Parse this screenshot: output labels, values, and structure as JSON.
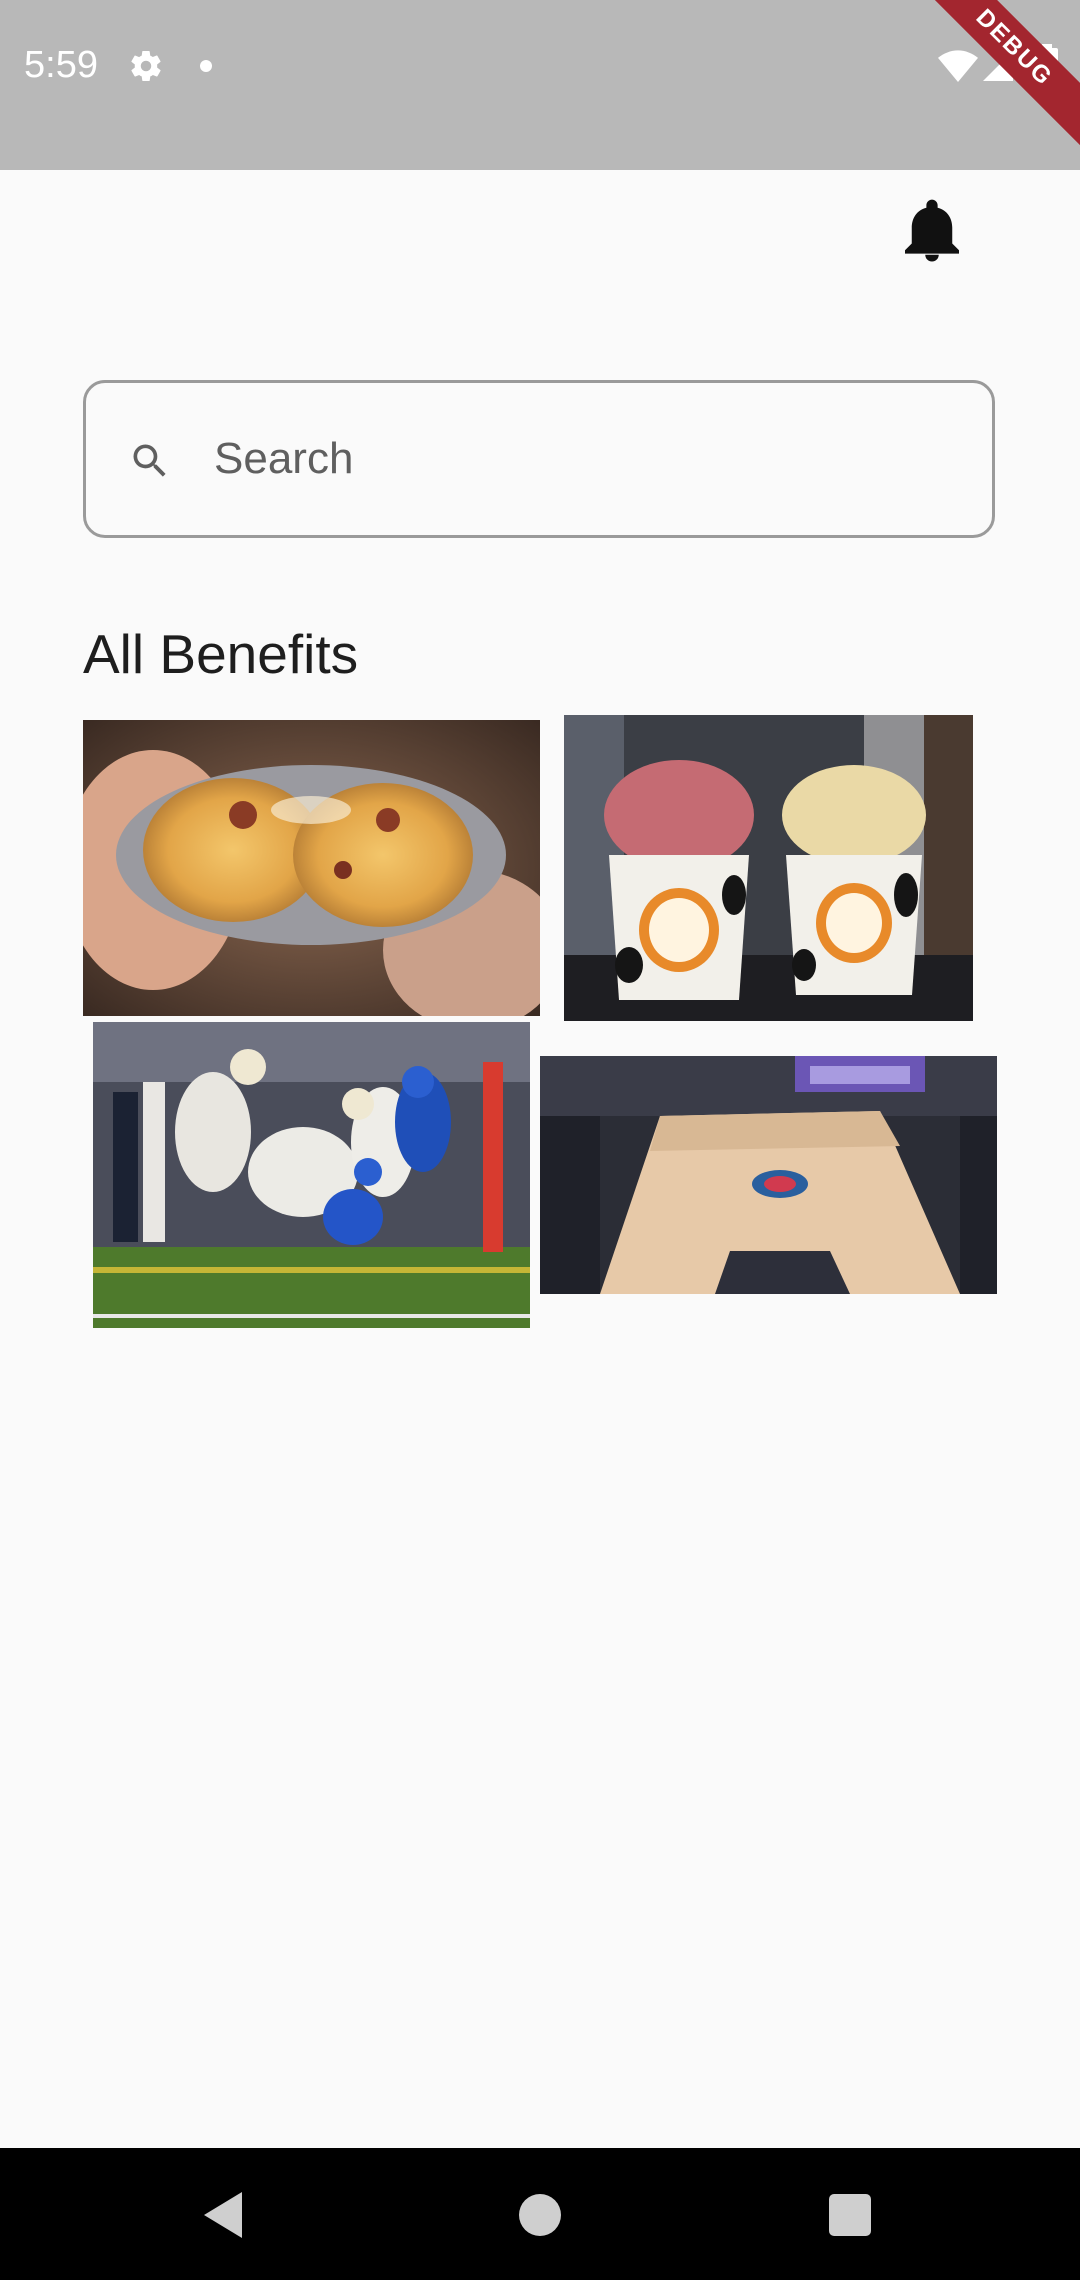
{
  "status_bar": {
    "time": "5:59",
    "icons": [
      "gear-icon",
      "notification-dot-icon",
      "wifi-icon",
      "signal-icon",
      "battery-icon"
    ],
    "debug_banner": "DEBUG"
  },
  "header": {
    "notification_icon": "bell-icon"
  },
  "search": {
    "placeholder": "Search",
    "value": ""
  },
  "section": {
    "title": "All Benefits"
  },
  "benefits": [
    {
      "image": "baked-potato-photo"
    },
    {
      "image": "ice-cream-cups-photo"
    },
    {
      "image": "football-game-photo"
    },
    {
      "image": "basketball-arena-photo"
    }
  ],
  "nav_bar": {
    "buttons": [
      "back-icon",
      "home-icon",
      "recents-icon"
    ]
  },
  "colors": {
    "status_bar_bg": "#b8b8b8",
    "background": "#fafafa",
    "debug_ribbon": "#a3262f",
    "nav_bar_bg": "#000000"
  }
}
